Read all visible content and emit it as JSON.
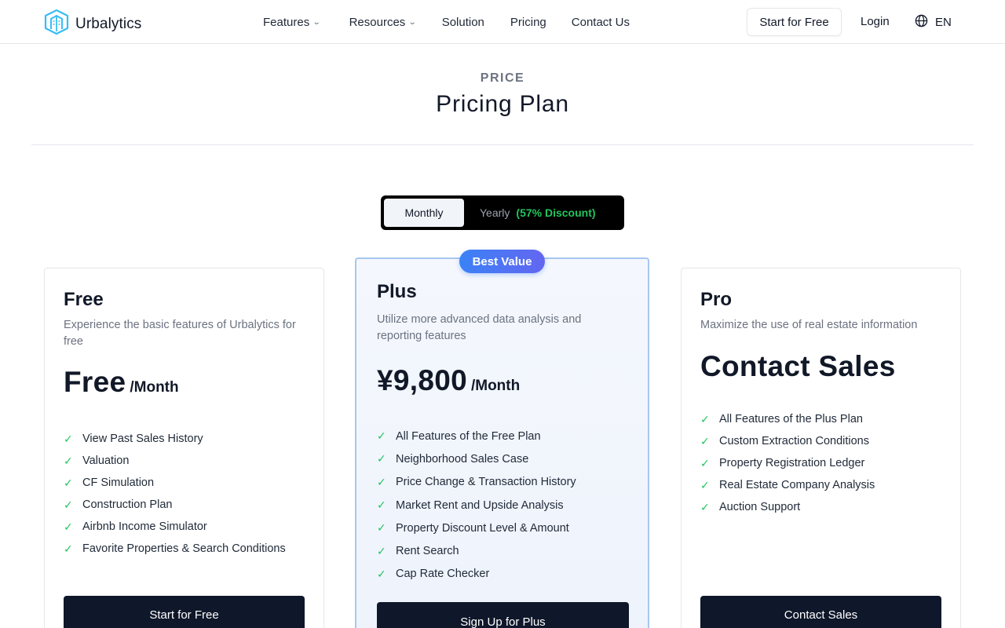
{
  "header": {
    "brand": "Urbalytics",
    "nav": [
      {
        "label": "Features",
        "has_dropdown": true
      },
      {
        "label": "Resources",
        "has_dropdown": true
      },
      {
        "label": "Solution",
        "has_dropdown": false
      },
      {
        "label": "Pricing",
        "has_dropdown": false
      },
      {
        "label": "Contact Us",
        "has_dropdown": false
      }
    ],
    "start_free_label": "Start for Free",
    "login_label": "Login",
    "language": "EN"
  },
  "hero": {
    "eyebrow": "PRICE",
    "title": "Pricing Plan"
  },
  "billing_toggle": {
    "monthly_label": "Monthly",
    "yearly_label": "Yearly",
    "yearly_discount": "(57% Discount)",
    "selected": "Monthly"
  },
  "plans": {
    "free": {
      "name": "Free",
      "description": "Experience the basic features of Urbalytics for free",
      "price": "Free",
      "unit": "/Month",
      "features": [
        "View Past Sales History",
        "Valuation",
        "CF Simulation",
        "Construction Plan",
        "Airbnb Income Simulator",
        "Favorite Properties & Search Conditions"
      ],
      "cta": "Start for Free"
    },
    "plus": {
      "badge": "Best Value",
      "name": "Plus",
      "description": "Utilize more advanced data analysis and reporting features",
      "price": "¥9,800",
      "unit": "/Month",
      "features": [
        "All Features of the Free Plan",
        "Neighborhood Sales Case",
        "Price Change & Transaction History",
        "Market Rent and Upside Analysis",
        "Property Discount Level & Amount",
        "Rent Search",
        "Cap Rate Checker"
      ],
      "cta": "Sign Up for Plus"
    },
    "pro": {
      "name": "Pro",
      "description": "Maximize the use of real estate information",
      "price": "Contact Sales",
      "features": [
        "All Features of the Plus Plan",
        "Custom Extraction Conditions",
        "Property Registration Ledger",
        "Real Estate Company Analysis",
        "Auction Support"
      ],
      "cta": "Contact Sales"
    }
  },
  "colors": {
    "accent_green": "#22c55e",
    "cta_dark": "#0f172a",
    "badge_gradient_start": "#3b82f6",
    "badge_gradient_end": "#6366f1",
    "logo_blue": "#38bdf8"
  },
  "icons": {
    "logo": "building-logo-icon",
    "dropdown": "chevron-down-icon",
    "language": "globe-icon",
    "feature": "check-icon"
  }
}
